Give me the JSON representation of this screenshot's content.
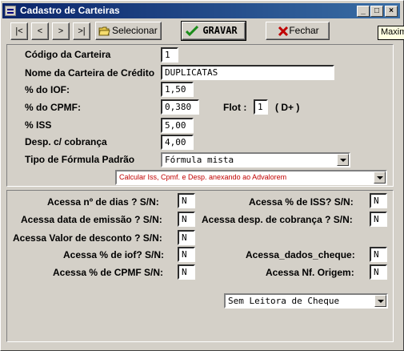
{
  "window": {
    "title": "Cadastro de  Carteiras",
    "controls": {
      "minimize": "_",
      "maximize": "□",
      "close": "×"
    },
    "tooltip": "Maxim"
  },
  "toolbar": {
    "nav_first": "|<",
    "nav_prev": "<",
    "nav_next": ">",
    "nav_last": ">|",
    "selecionar_label": "Selecionar",
    "gravar_label": "GRAVAR",
    "fechar_label": "Fechar"
  },
  "form": {
    "codigo": {
      "label": "Código da Carteira",
      "value": "1"
    },
    "nome": {
      "label": "Nome da Carteira de Crédito",
      "value": "DUPLICATAS"
    },
    "iof": {
      "label": "% do IOF:",
      "value": "1,50"
    },
    "cpmf": {
      "label": "% do CPMF:",
      "value": "0,380"
    },
    "flot": {
      "label": "Flot :",
      "value": "1",
      "suffix": "( D+ )"
    },
    "iss": {
      "label": "% ISS",
      "value": "5,00"
    },
    "desp": {
      "label": "Desp. c/ cobrança",
      "value": "4,00"
    },
    "formula": {
      "label": "Tipo de Fórmula Padrão",
      "value": "Fórmula mista"
    },
    "calculo": {
      "value": "Calcular Iss, Cpmf. e Desp. anexando ao Advalorem"
    }
  },
  "flags": {
    "left": [
      {
        "label": "Acessa  nº de dias ? S/N:",
        "value": "N"
      },
      {
        "label": "Acessa data de emissão ? S/N:",
        "value": "N"
      },
      {
        "label": "Acessa Valor de desconto ? S/N:",
        "value": "N"
      },
      {
        "label": "Acessa % de iof? S/N:",
        "value": "N"
      },
      {
        "label": "Acessa % de CPMF S/N:",
        "value": "N"
      }
    ],
    "right": [
      {
        "label": "Acessa % de ISS? S/N:",
        "value": "N"
      },
      {
        "label": "Acessa desp. de cobrança ? S/N:",
        "value": "N"
      },
      {
        "label": "Acessa_dados_cheque:",
        "value": "N"
      },
      {
        "label": "Acessa Nf. Origem:",
        "value": "N"
      }
    ],
    "leitora": "Sem Leitora de Cheque"
  },
  "colors": {
    "titlebar_start": "#0a246a",
    "titlebar_end": "#3a6ea5",
    "face": "#d4d0c8",
    "gravar_check": "#1a8c1a",
    "fechar_x": "#c00000",
    "calculo_text": "#c00000"
  }
}
